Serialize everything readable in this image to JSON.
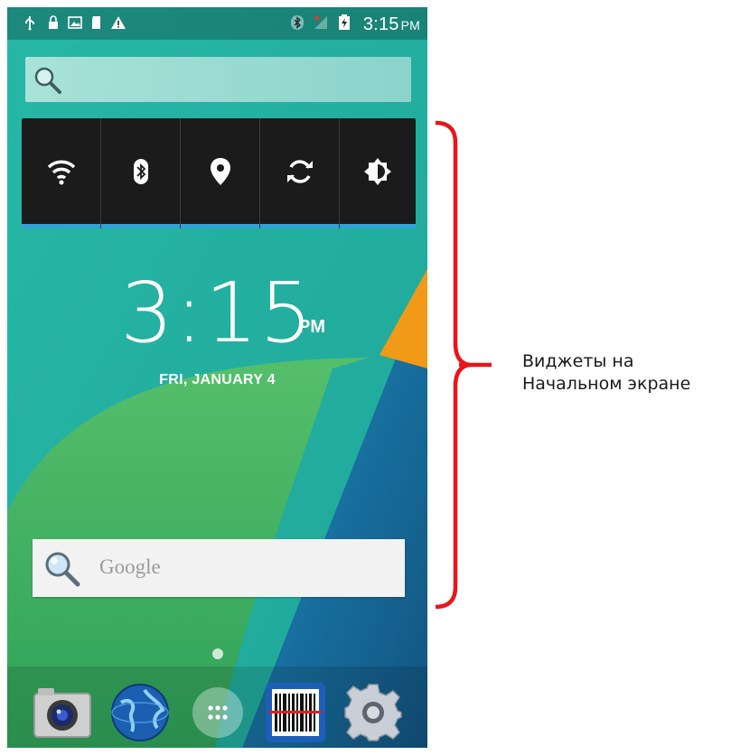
{
  "status_bar": {
    "left_icons": [
      "usb-icon",
      "lock-icon",
      "image-icon",
      "sd-card-icon",
      "warning-icon"
    ],
    "right_icons": [
      "bluetooth-icon",
      "no-signal-icon",
      "battery-charging-icon"
    ],
    "time": "3:15",
    "ampm": "PM"
  },
  "top_search": {
    "icon": "search-icon"
  },
  "power_control": {
    "buttons": [
      {
        "name": "wifi",
        "icon": "wifi-icon",
        "active": true
      },
      {
        "name": "bluetooth",
        "icon": "bluetooth-icon",
        "active": true
      },
      {
        "name": "location",
        "icon": "location-icon",
        "active": true
      },
      {
        "name": "sync",
        "icon": "sync-icon",
        "active": true
      },
      {
        "name": "brightness",
        "icon": "brightness-icon",
        "active": true
      }
    ],
    "accent_color": "#2fa3d8"
  },
  "clock": {
    "time": "3:15",
    "ampm": "PM",
    "date": "FRI, JANUARY 4"
  },
  "google_search": {
    "text": "Google",
    "icon": "search-icon"
  },
  "dock": {
    "apps": [
      {
        "name": "camera",
        "icon": "camera-icon"
      },
      {
        "name": "browser",
        "icon": "globe-icon"
      },
      {
        "name": "all-apps",
        "icon": "app-drawer-icon"
      },
      {
        "name": "barcode-scanner",
        "icon": "barcode-icon"
      },
      {
        "name": "settings",
        "icon": "gear-icon"
      }
    ]
  },
  "annotation": {
    "line1": "Виджеты на",
    "line2": "Начальном экране",
    "bracket_color": "#e8151b"
  },
  "colors": {
    "wallpaper_teal": "#22b5a0",
    "wallpaper_green": "#4cba66",
    "wallpaper_blue": "#1a77b5",
    "wallpaper_orange": "#f09a17"
  }
}
